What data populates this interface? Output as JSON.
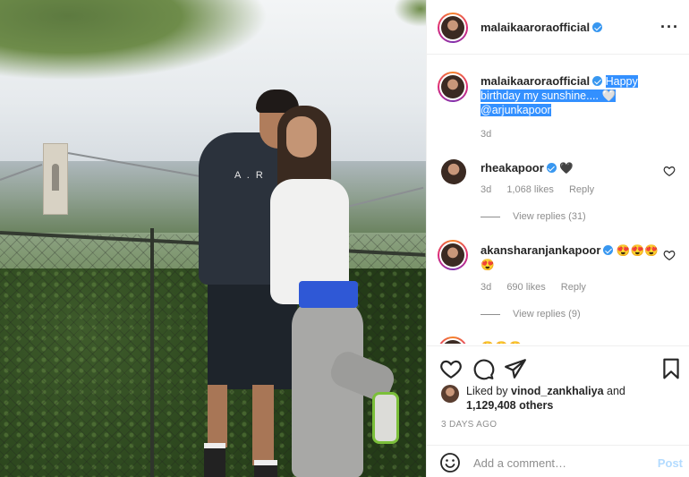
{
  "post": {
    "author": "malaikaaroraofficial",
    "more_icon": "more-icon"
  },
  "caption": {
    "username": "malaikaaroraofficial",
    "text_line1": "Happy",
    "text_line2": "birthday my sunshine.... 🤍",
    "text_line3": "@arjunkapoor",
    "age": "3d"
  },
  "comments": [
    {
      "username": "rheakapoor",
      "text": "🖤",
      "age": "3d",
      "likes": "1,068 likes",
      "reply": "Reply",
      "view_replies": "View replies (31)"
    },
    {
      "username": "akansharanjankapoor",
      "text": "😍😍😍",
      "text2": "😍",
      "age": "3d",
      "likes": "690 likes",
      "reply": "Reply",
      "view_replies": "View replies (9)"
    },
    {
      "username": "",
      "text": "😍😍😍"
    }
  ],
  "likes": {
    "prefix": "Liked by ",
    "user": "vinod_zankhaliya",
    "and": " and",
    "count": "1,129,408 others"
  },
  "timestamp": "3 DAYS AGO",
  "add_comment": {
    "placeholder": "Add a comment…",
    "post_label": "Post"
  },
  "colors": {
    "verified": "#3897f0",
    "highlight": "#3390ff",
    "post_disabled": "#b3dbff"
  }
}
